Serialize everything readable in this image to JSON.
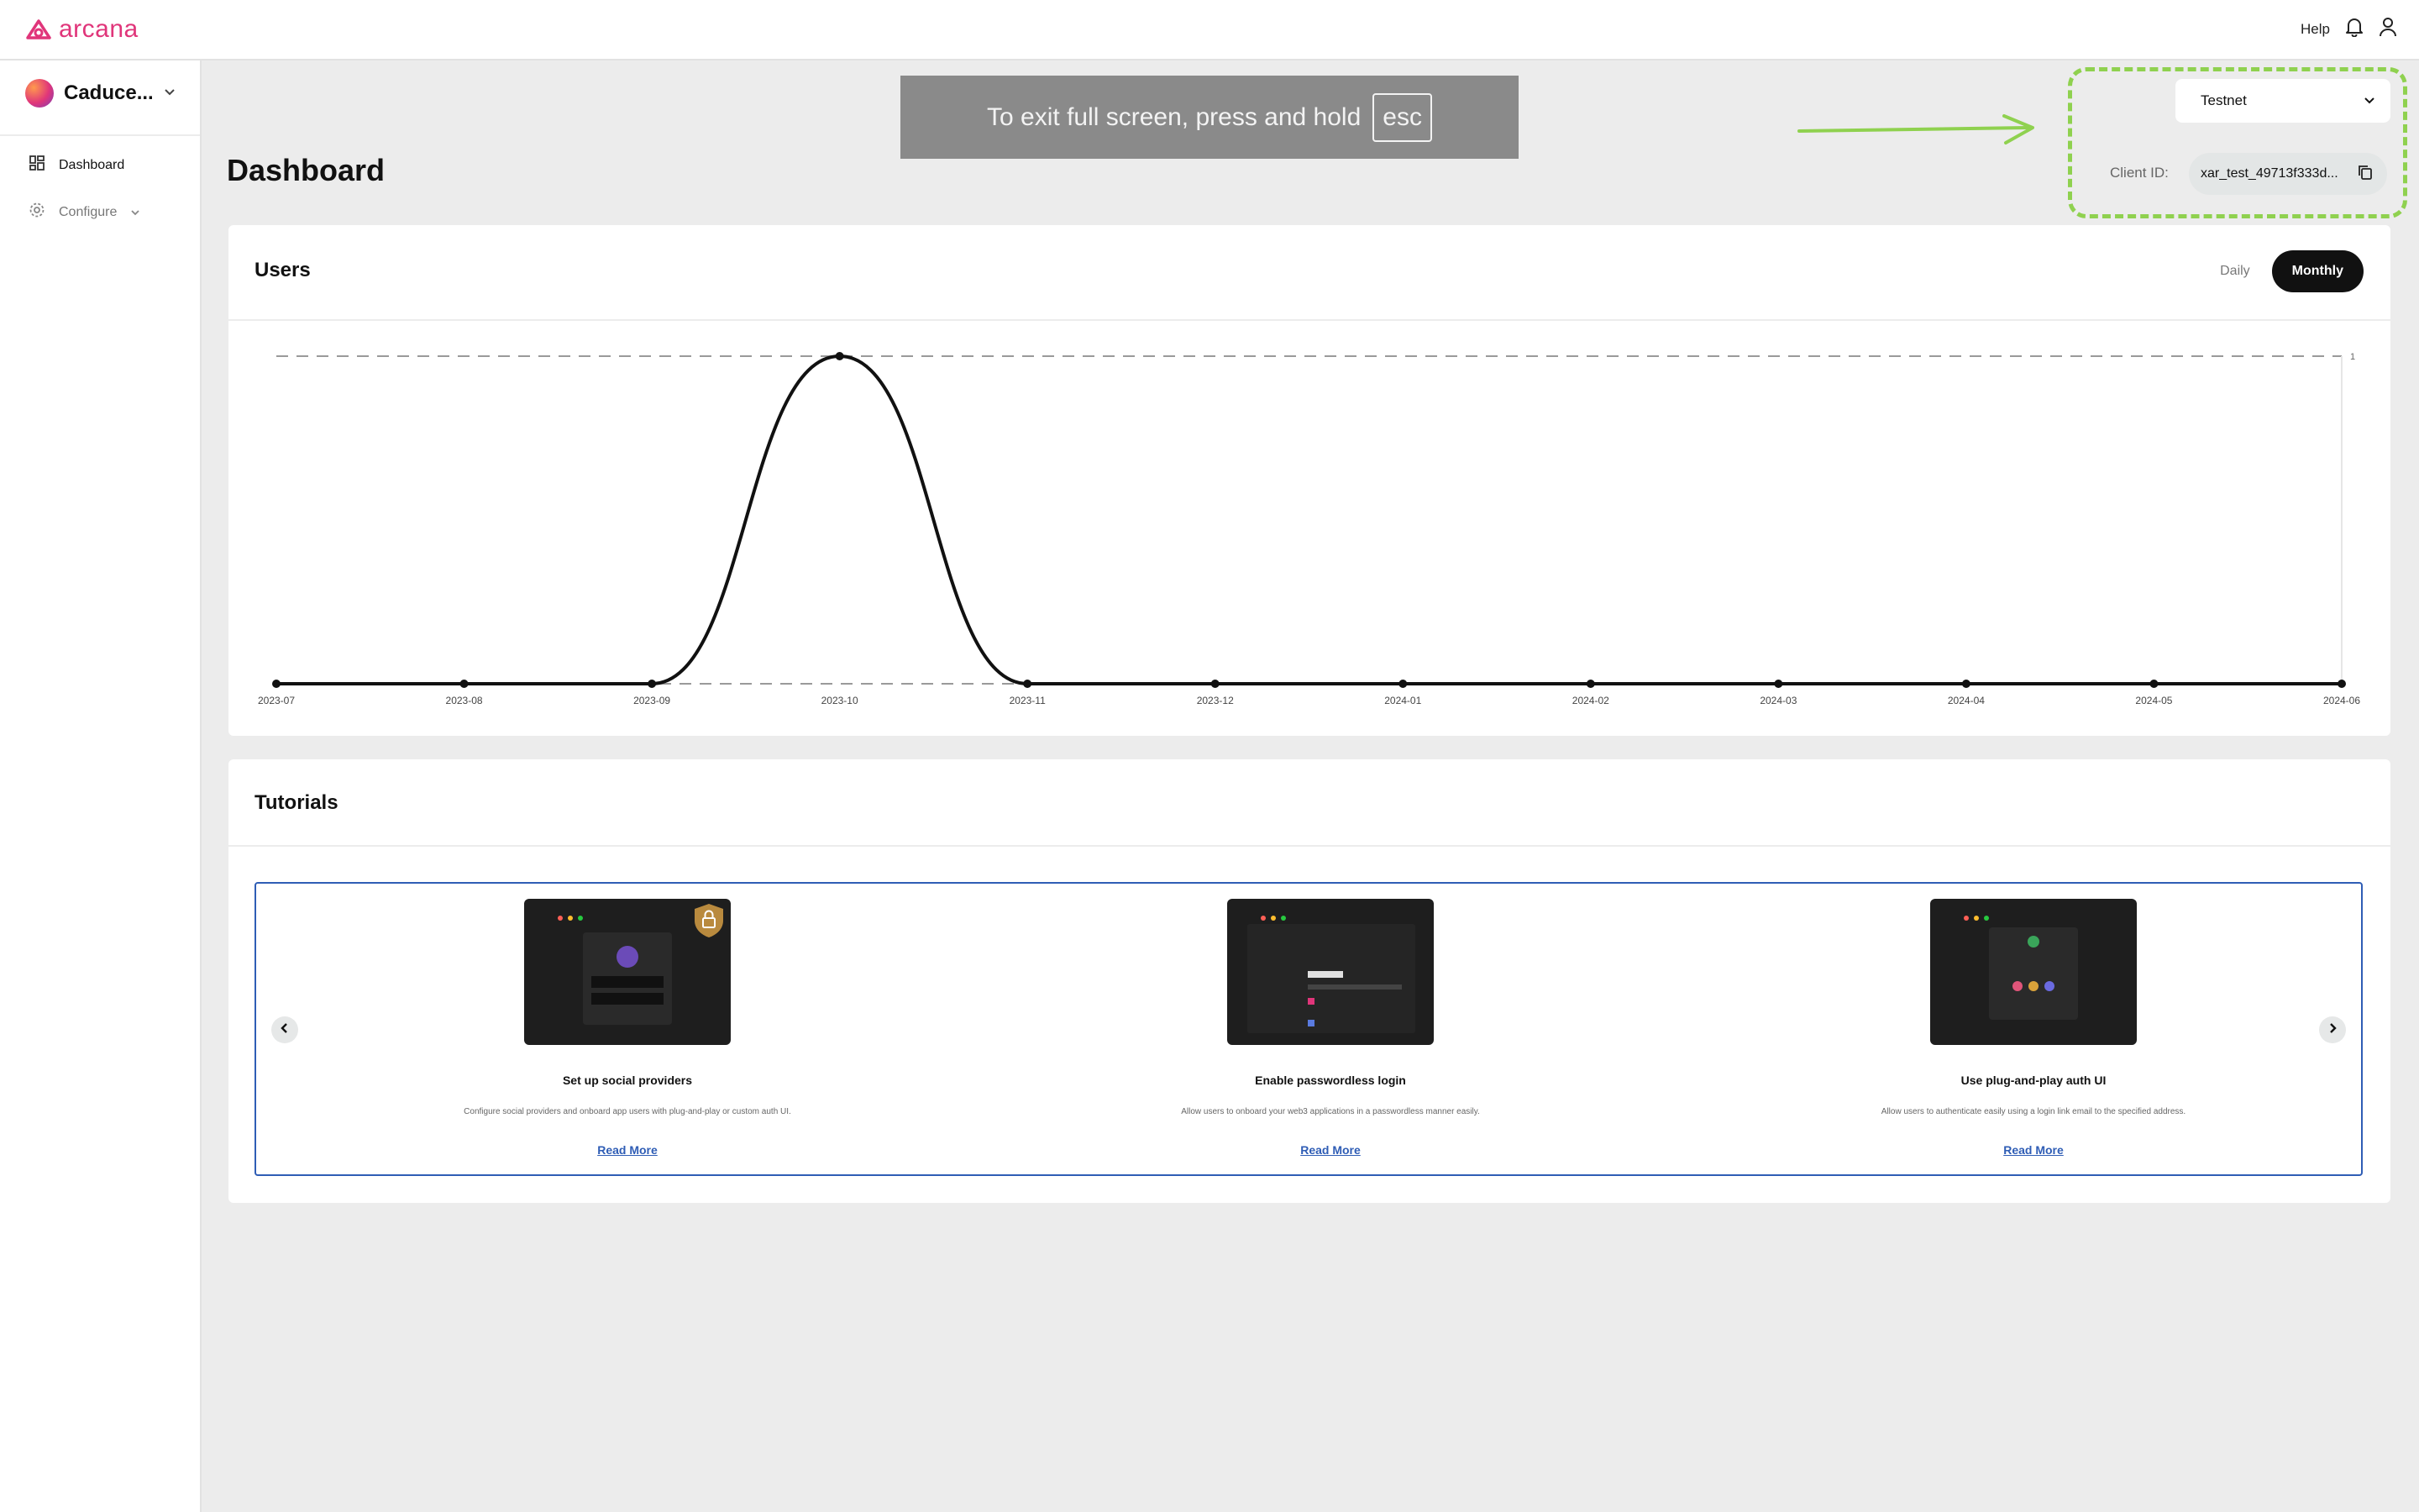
{
  "brand": {
    "name": "arcana",
    "color": "#e0357a"
  },
  "topbar": {
    "help_label": "Help",
    "icons": [
      "bell-icon",
      "user-icon"
    ]
  },
  "sidebar": {
    "app_name": "Caduce...",
    "items": [
      {
        "label": "Dashboard",
        "icon": "grid-icon",
        "active": true
      },
      {
        "label": "Configure",
        "icon": "gear-icon",
        "active": false
      }
    ]
  },
  "page": {
    "title": "Dashboard"
  },
  "fullscreen_notice": {
    "text": "To exit full screen, press and hold",
    "key": "esc"
  },
  "network": {
    "selected": "Testnet"
  },
  "client": {
    "label": "Client ID:",
    "value": "xar_test_49713f333d..."
  },
  "users_card": {
    "title": "Users",
    "toggle_daily": "Daily",
    "toggle_monthly": "Monthly",
    "active_toggle": "Monthly"
  },
  "chart_data": {
    "type": "line",
    "title": "Users",
    "x": [
      "2023-07",
      "2023-08",
      "2023-09",
      "2023-10",
      "2023-11",
      "2023-12",
      "2024-01",
      "2024-02",
      "2024-03",
      "2024-04",
      "2024-05",
      "2024-06"
    ],
    "series": [
      {
        "values": [
          0,
          0,
          0,
          1,
          0,
          0,
          0,
          0,
          0,
          0,
          0,
          0
        ]
      }
    ],
    "ylim": [
      0,
      1
    ],
    "y_ticks": [
      "1"
    ],
    "grid": "dashed horizontal"
  },
  "tutorials": {
    "title": "Tutorials",
    "items": [
      {
        "title": "Set up social providers",
        "desc": "Configure social providers and onboard app users with plug-and-play or custom auth UI.",
        "link": "Read More"
      },
      {
        "title": "Enable passwordless login",
        "desc": "Allow users to onboard your web3 applications in a passwordless manner easily.",
        "link": "Read More"
      },
      {
        "title": "Use plug-and-play auth UI",
        "desc": "Allow users to authenticate easily using a login link email to the specified address.",
        "link": "Read More"
      }
    ]
  },
  "colors": {
    "accent": "#111111",
    "highlight": "#8fd14f",
    "link": "#2f5db5"
  }
}
